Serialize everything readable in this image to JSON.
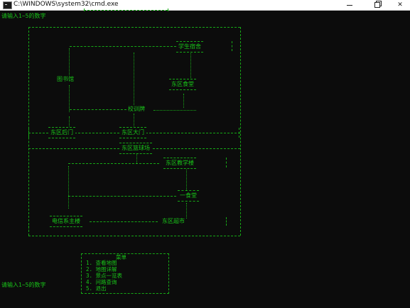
{
  "window": {
    "title": "C:\\WINDOWS\\system32\\cmd.exe",
    "minimize_label": "",
    "maximize_label": "",
    "close_label": ""
  },
  "console": {
    "prompt_top": "请输入1~5的数字",
    "prompt_bottom": "请输入1~5的数字",
    "top_box_text": "|---------------------------|",
    "map_nodes": [
      {
        "id": "dorm",
        "label": "学生宿舍"
      },
      {
        "id": "library",
        "label": "图书馆"
      },
      {
        "id": "east-canteen",
        "label": "东区食堂"
      },
      {
        "id": "school-motto",
        "label": "校训牌"
      },
      {
        "id": "east-back-gate",
        "label": "东区后门"
      },
      {
        "id": "east-gate",
        "label": "东区大门"
      },
      {
        "id": "east-court",
        "label": "东区篮球场"
      },
      {
        "id": "east-teaching",
        "label": "东区教学楼"
      },
      {
        "id": "canteen-one",
        "label": "一食堂"
      },
      {
        "id": "telecom-building",
        "label": "电信系主楼"
      },
      {
        "id": "east-market",
        "label": "东区超市"
      }
    ],
    "menu": {
      "title": "菜单",
      "items": [
        {
          "index": "1",
          "label": "查看地图"
        },
        {
          "index": "2",
          "label": "地图详解"
        },
        {
          "index": "3",
          "label": "景点一览表"
        },
        {
          "index": "4",
          "label": "问路查询"
        },
        {
          "index": "5",
          "label": "退出"
        }
      ]
    }
  },
  "colors": {
    "console_bg": "#0c0c0c",
    "console_fg": "#19c419",
    "titlebar_bg": "#ffffff"
  }
}
